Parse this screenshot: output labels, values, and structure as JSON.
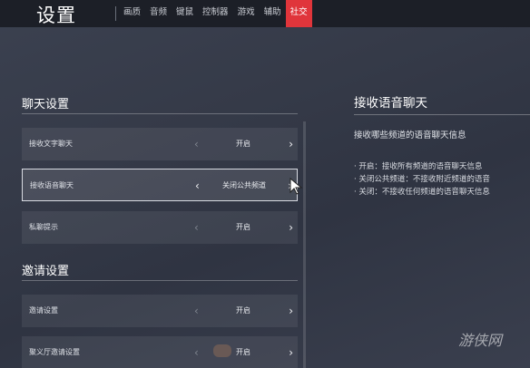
{
  "header": {
    "title": "设置",
    "tabs": [
      {
        "label": "画质"
      },
      {
        "label": "音频"
      },
      {
        "label": "键鼠"
      },
      {
        "label": "控制器"
      },
      {
        "label": "游戏"
      },
      {
        "label": "辅助"
      },
      {
        "label": "社交"
      }
    ],
    "active_tab": "社交"
  },
  "sections": {
    "chat": {
      "title": "聊天设置",
      "rows": [
        {
          "label": "接收文字聊天",
          "value": "开启"
        },
        {
          "label": "接收语音聊天",
          "value": "关闭公共频道"
        },
        {
          "label": "私聊提示",
          "value": "开启"
        }
      ]
    },
    "invite": {
      "title": "邀请设置",
      "rows": [
        {
          "label": "邀请设置",
          "value": "开启"
        },
        {
          "label": "聚义厅邀请设置",
          "value": "开启"
        }
      ]
    }
  },
  "detail": {
    "title": "接收语音聊天",
    "description": "接收哪些频道的语音聊天信息",
    "options": [
      "· 开启：接收所有频道的语音聊天信息",
      "· 关闭公共频道：不接收附近频道的语音",
      "· 关闭：不接收任何频道的语音聊天信息"
    ]
  },
  "watermark": "游侠网",
  "colors": {
    "accent": "#e0353b",
    "topbar": "#1c1f27",
    "background": "#353a48"
  },
  "icons": {
    "left_arrow": "chevron-left-icon",
    "right_arrow": "chevron-right-icon",
    "cursor": "mouse-cursor-icon"
  }
}
